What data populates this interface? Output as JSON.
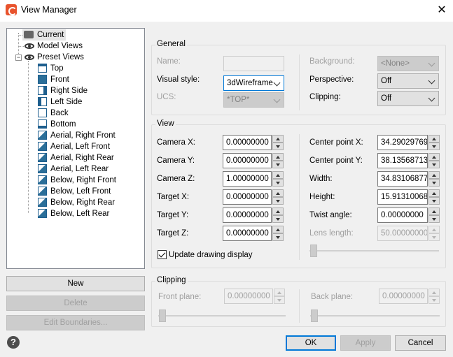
{
  "window": {
    "title": "View Manager",
    "close_glyph": "✕"
  },
  "tree": {
    "items": [
      {
        "label": "Current",
        "icon": "camera-icon"
      },
      {
        "label": "Model Views",
        "icon": "eye-icon"
      },
      {
        "label": "Preset Views",
        "icon": "eye-icon"
      },
      {
        "label": "Top",
        "icon": "cube-top-icon"
      },
      {
        "label": "Front",
        "icon": "cube-front-icon"
      },
      {
        "label": "Right Side",
        "icon": "cube-right-icon"
      },
      {
        "label": "Left Side",
        "icon": "cube-left-icon"
      },
      {
        "label": "Back",
        "icon": "cube-back-icon"
      },
      {
        "label": "Bottom",
        "icon": "cube-bottom-icon"
      },
      {
        "label": "Aerial, Right Front",
        "icon": "cube-iso-icon"
      },
      {
        "label": "Aerial, Left Front",
        "icon": "cube-iso-icon"
      },
      {
        "label": "Aerial, Right Rear",
        "icon": "cube-iso-icon"
      },
      {
        "label": "Aerial, Left Rear",
        "icon": "cube-iso-icon"
      },
      {
        "label": "Below, Right Front",
        "icon": "cube-iso-icon"
      },
      {
        "label": "Below, Left Front",
        "icon": "cube-iso-icon"
      },
      {
        "label": "Below, Right Rear",
        "icon": "cube-iso-icon"
      },
      {
        "label": "Below, Left Rear",
        "icon": "cube-iso-icon"
      }
    ],
    "expander_glyph": "−"
  },
  "left_buttons": {
    "new": "New",
    "delete": "Delete",
    "edit_boundaries": "Edit Boundaries..."
  },
  "general": {
    "title": "General",
    "name_label": "Name:",
    "name_value": "",
    "visual_style_label": "Visual style:",
    "visual_style_value": "3dWireframe",
    "ucs_label": "UCS:",
    "ucs_value": "*TOP*",
    "background_label": "Background:",
    "background_value": "<None>",
    "perspective_label": "Perspective:",
    "perspective_value": "Off",
    "clipping_label": "Clipping:",
    "clipping_value": "Off"
  },
  "view": {
    "title": "View",
    "camera_x_label": "Camera X:",
    "camera_x": "0.00000000",
    "camera_y_label": "Camera Y:",
    "camera_y": "0.00000000",
    "camera_z_label": "Camera Z:",
    "camera_z": "1.00000000",
    "target_x_label": "Target X:",
    "target_x": "0.00000000",
    "target_y_label": "Target Y:",
    "target_y": "0.00000000",
    "target_z_label": "Target Z:",
    "target_z": "0.00000000",
    "center_x_label": "Center point X:",
    "center_x": "34.29029769",
    "center_y_label": "Center point Y:",
    "center_y": "38.13568713",
    "width_label": "Width:",
    "width": "34.83106877",
    "height_label": "Height:",
    "height": "15.91310068",
    "twist_label": "Twist angle:",
    "twist": "0.00000000",
    "lens_label": "Lens length:",
    "lens": "50.00000000",
    "update_display_label": "Update drawing display",
    "update_display_checked": true
  },
  "clipping": {
    "title": "Clipping",
    "front_label": "Front plane:",
    "front": "0.00000000",
    "back_label": "Back plane:",
    "back": "0.00000000"
  },
  "footer": {
    "ok": "OK",
    "apply": "Apply",
    "cancel": "Cancel",
    "help_glyph": "?"
  },
  "colors": {
    "accent": "#0078d7",
    "icon_blue": "#2b6f99"
  }
}
